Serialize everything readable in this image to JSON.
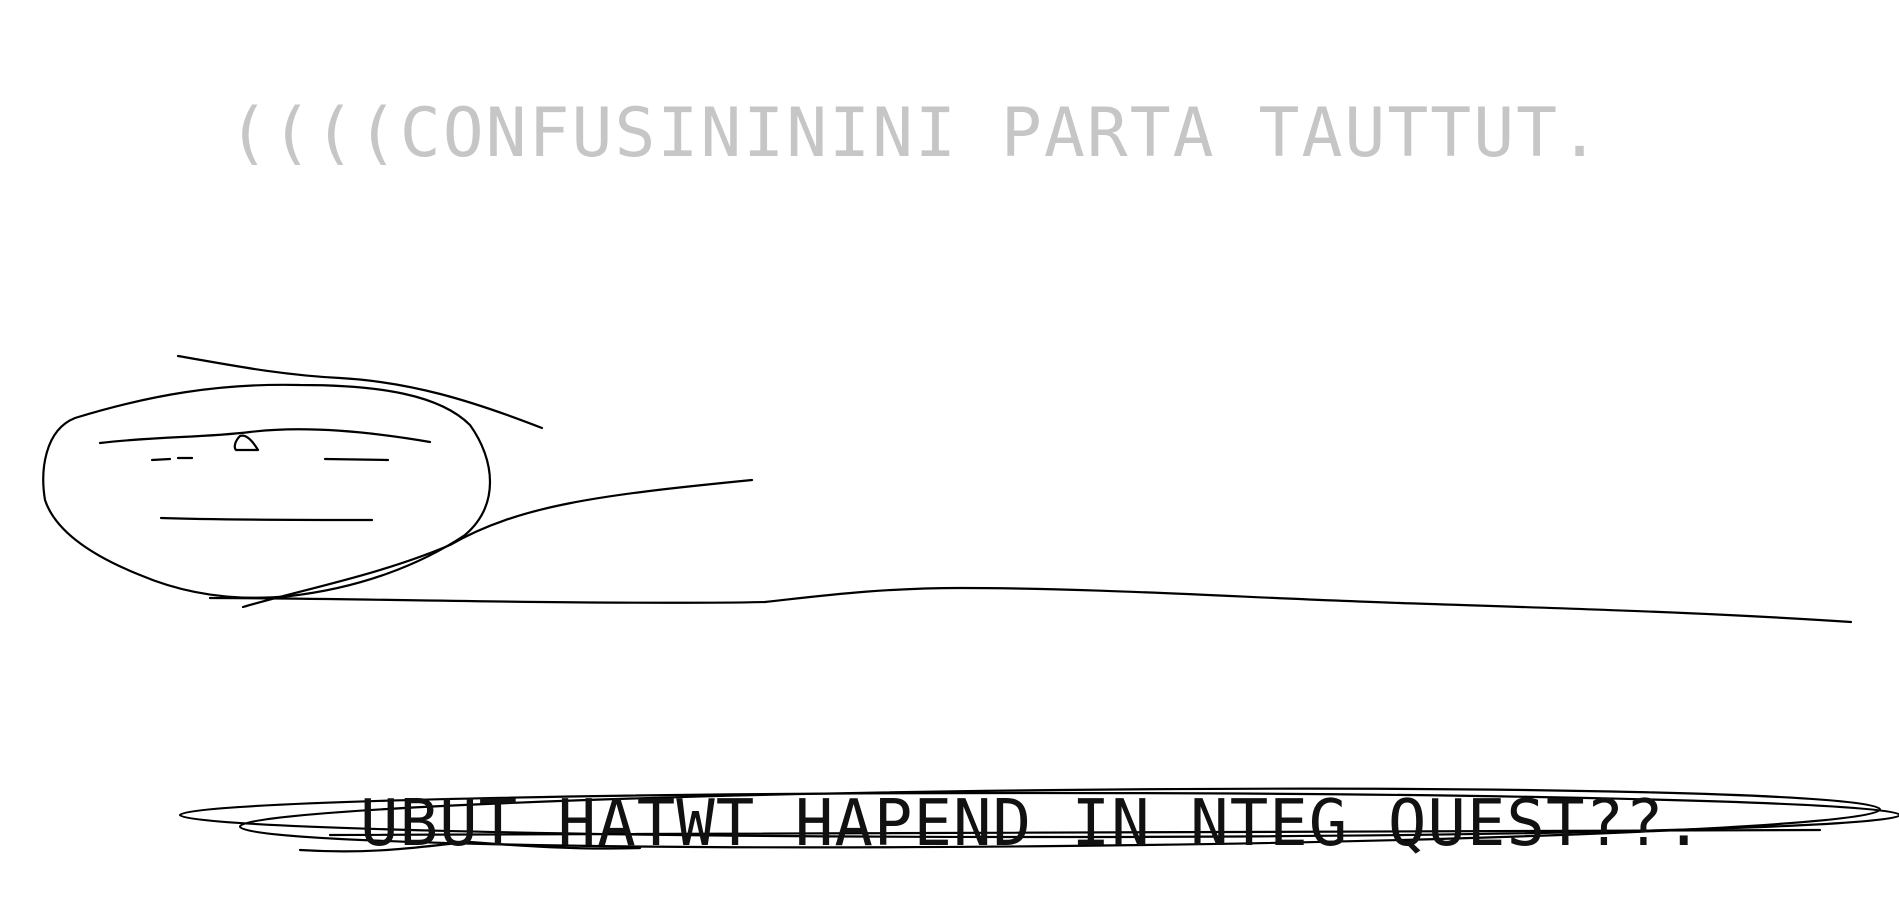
{
  "captions": {
    "top": "((((CONFUSINININI PARTA TAUTTUT.",
    "bottom": "UBUT HATWT HAPEND IN NTEG QUEST??."
  },
  "colors": {
    "background": "#ffffff",
    "top_caption": "#c6c6c6",
    "bottom_caption": "#111111",
    "ink": "#000000"
  }
}
